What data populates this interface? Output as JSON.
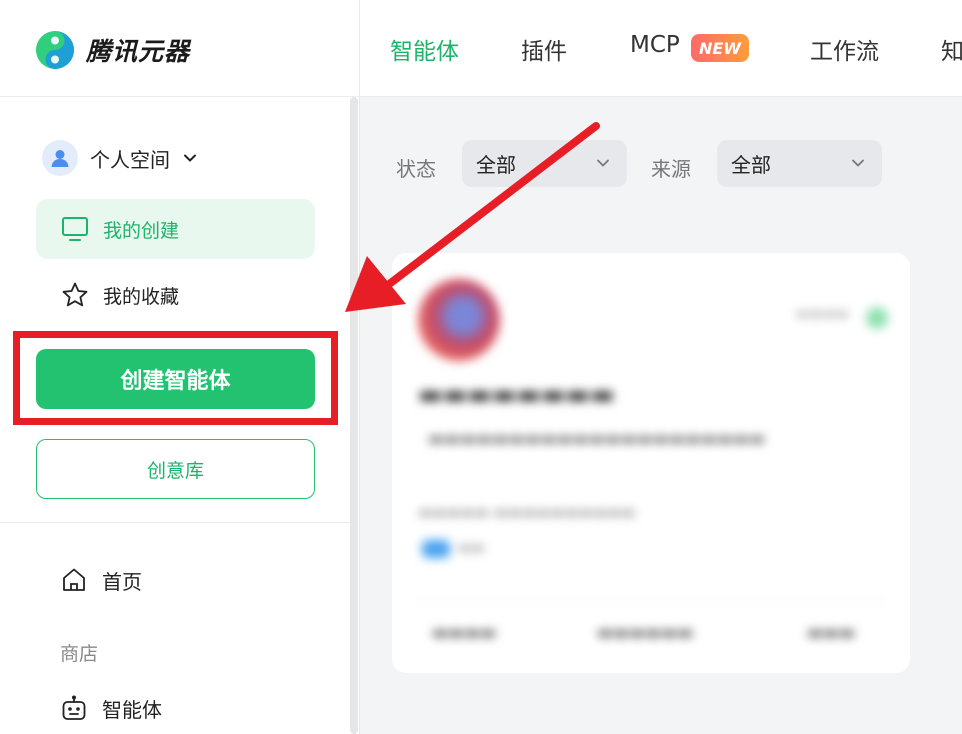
{
  "app": {
    "brand_name": "腾讯元器",
    "accent_color": "#22c270",
    "annotation_color": "#e81e26"
  },
  "sidebar": {
    "space_switcher": {
      "label": "个人空间",
      "icon": "user-avatar-icon",
      "dropdown_icon": "chevron-down-icon"
    },
    "items": [
      {
        "label": "我的创建",
        "icon": "monitor-icon",
        "active": true
      },
      {
        "label": "我的收藏",
        "icon": "star-icon",
        "active": false
      }
    ],
    "create_button": "创建智能体",
    "idea_library_button": "创意库",
    "home": {
      "label": "首页",
      "icon": "home-icon"
    },
    "store_section": "商店",
    "store_items": [
      {
        "label": "智能体",
        "icon": "robot-icon"
      }
    ]
  },
  "topnav": {
    "tabs": [
      {
        "label": "智能体",
        "active": true
      },
      {
        "label": "插件",
        "active": false
      },
      {
        "label": "MCP",
        "active": false,
        "badge": "NEW"
      },
      {
        "label": "工作流",
        "active": false
      },
      {
        "label": "知",
        "active": false
      }
    ]
  },
  "filters": {
    "status": {
      "label": "状态",
      "value": "全部"
    },
    "source": {
      "label": "来源",
      "value": "全部"
    }
  }
}
